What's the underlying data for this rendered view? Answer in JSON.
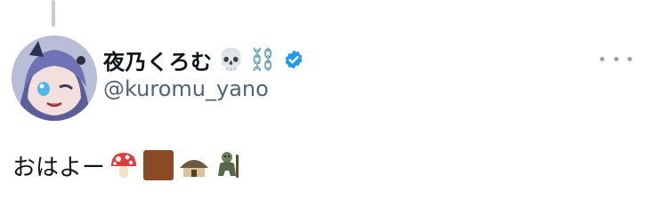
{
  "tweet": {
    "author": {
      "display_name": "夜乃くろむ",
      "name_emojis": [
        "💀",
        "⛓️"
      ],
      "handle": "@kuromu_yano",
      "verified": true,
      "verified_color": "#1d9bf0"
    },
    "text": "おはよー",
    "emojis": [
      "mushroom-emoji",
      "brown-square-emoji",
      "hut-emoji",
      "troll-emoji"
    ],
    "more_menu": "more-options-icon"
  }
}
